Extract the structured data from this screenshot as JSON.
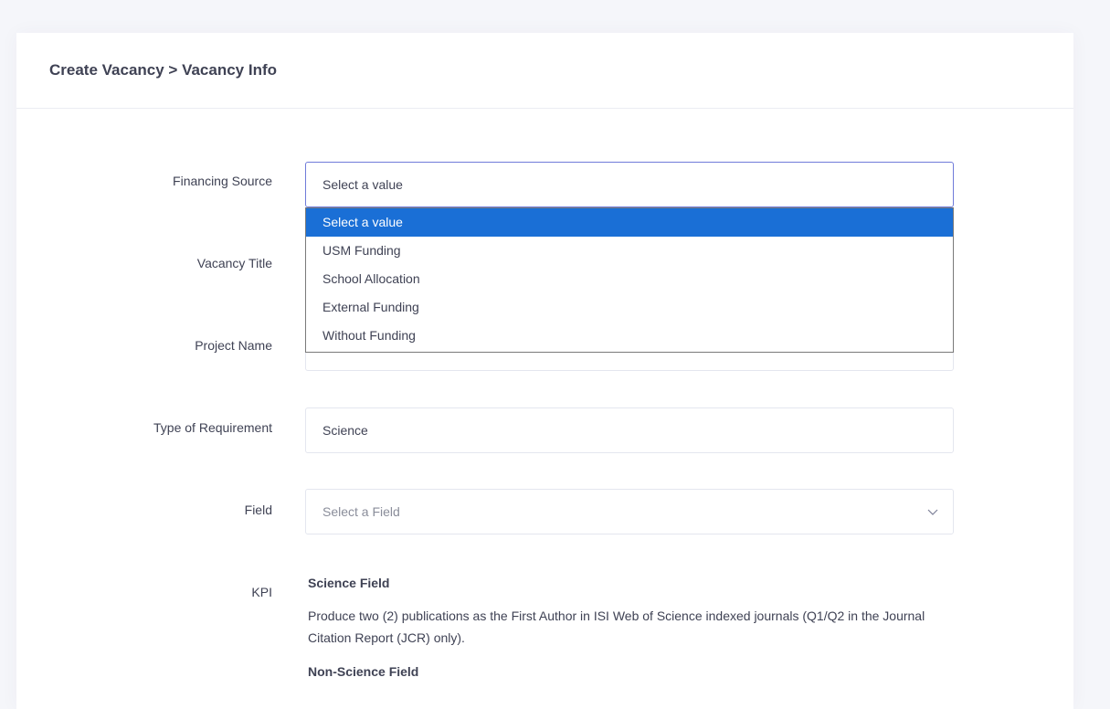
{
  "header": {
    "title": "Create Vacancy > Vacancy Info"
  },
  "form": {
    "financing_source": {
      "label": "Financing Source",
      "value": "Select a value",
      "options": [
        "Select a value",
        "USM Funding",
        "School Allocation",
        "External Funding",
        "Without Funding"
      ],
      "selected_index": 0
    },
    "vacancy_title": {
      "label": "Vacancy Title"
    },
    "project_name": {
      "label": "Project Name"
    },
    "type_of_requirement": {
      "label": "Type of Requirement",
      "value": "Science"
    },
    "field": {
      "label": "Field",
      "placeholder": "Select a Field"
    },
    "kpi": {
      "label": "KPI",
      "science_heading": "Science Field",
      "science_text": "Produce two (2) publications as the First Author in ISI Web of Science indexed journals (Q1/Q2 in the Journal Citation Report (JCR) only).",
      "non_science_heading": "Non-Science Field"
    }
  },
  "colors": {
    "selected_option_bg": "#1a6fd6",
    "focus_border": "#6f7bd9"
  },
  "icons": {
    "field_dropdown": "chevron-down-icon"
  }
}
